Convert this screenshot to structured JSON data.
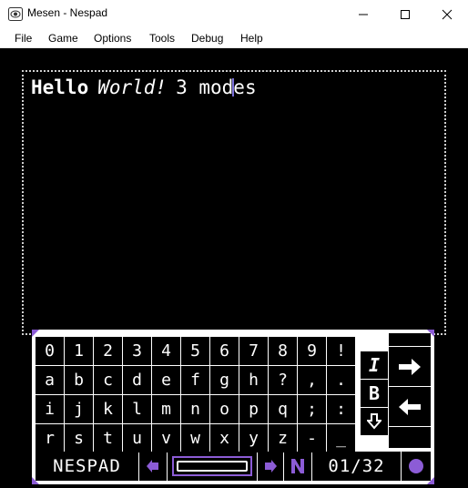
{
  "window": {
    "title": "Mesen - Nespad",
    "minimize_icon": "minimize-icon",
    "maximize_icon": "maximize-icon",
    "close_icon": "close-icon"
  },
  "menu": [
    "File",
    "Game",
    "Options",
    "Tools",
    "Debug",
    "Help"
  ],
  "editor": {
    "hello": "Hello",
    "world": "World!",
    "rest": "3 mod",
    "after_cursor": "es"
  },
  "keyboard": {
    "rows": [
      [
        "0",
        "1",
        "2",
        "3",
        "4",
        "5",
        "6",
        "7",
        "8",
        "9",
        "!"
      ],
      [
        "a",
        "b",
        "c",
        "d",
        "e",
        "f",
        "g",
        "h",
        "?",
        ",",
        "."
      ],
      [
        "i",
        "j",
        "k",
        "l",
        "m",
        "n",
        "o",
        "p",
        "q",
        ";",
        ":"
      ],
      [
        "r",
        "s",
        "t",
        "u",
        "v",
        "w",
        "x",
        "y",
        "z",
        "-",
        "_"
      ]
    ],
    "side_keys": {
      "italic": "I",
      "bold": "B",
      "shift_icon": "shift-down-arrow-icon"
    },
    "right_keys": {
      "enter_icon": "right-arrow-icon",
      "backspace_icon": "left-arrow-icon"
    },
    "bottom": {
      "brand": "NESPAD",
      "prev_icon": "left-triangle-icon",
      "next_icon": "right-triangle-icon",
      "mode_icon": "n-logo-icon",
      "page": "01/32",
      "record_icon": "circle-icon"
    },
    "colors": {
      "accent": "#8c5cd6",
      "key_bg": "#000000",
      "grid": "#ffffff"
    }
  }
}
